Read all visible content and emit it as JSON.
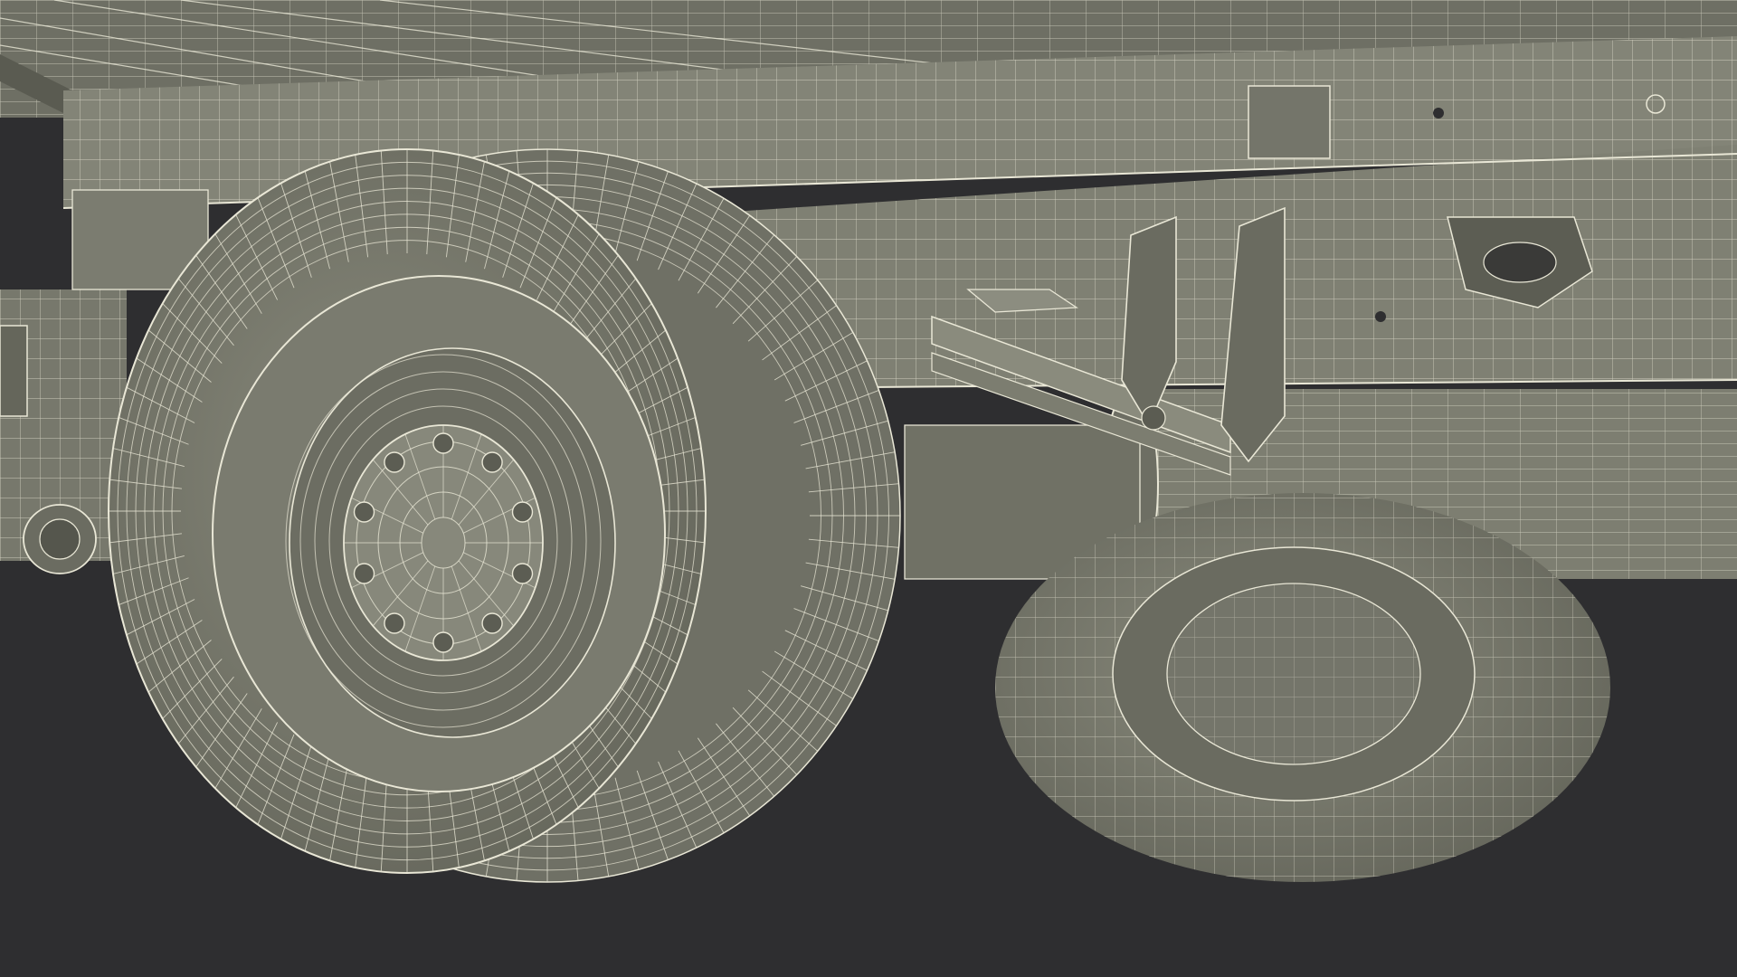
{
  "scene": {
    "subject": "truck-rear-chassis-wireframe",
    "visible_text": []
  },
  "colors": {
    "background": "#2e2e30",
    "surface": "#7e7f72",
    "surface_dark": "#5f6056",
    "surface_light": "#9a9b8c",
    "wire": "#e9e7d6"
  },
  "counts": {
    "front_wheel_lug_nuts": 10,
    "tire_tread_segments": 72,
    "tire_rings": 7
  }
}
